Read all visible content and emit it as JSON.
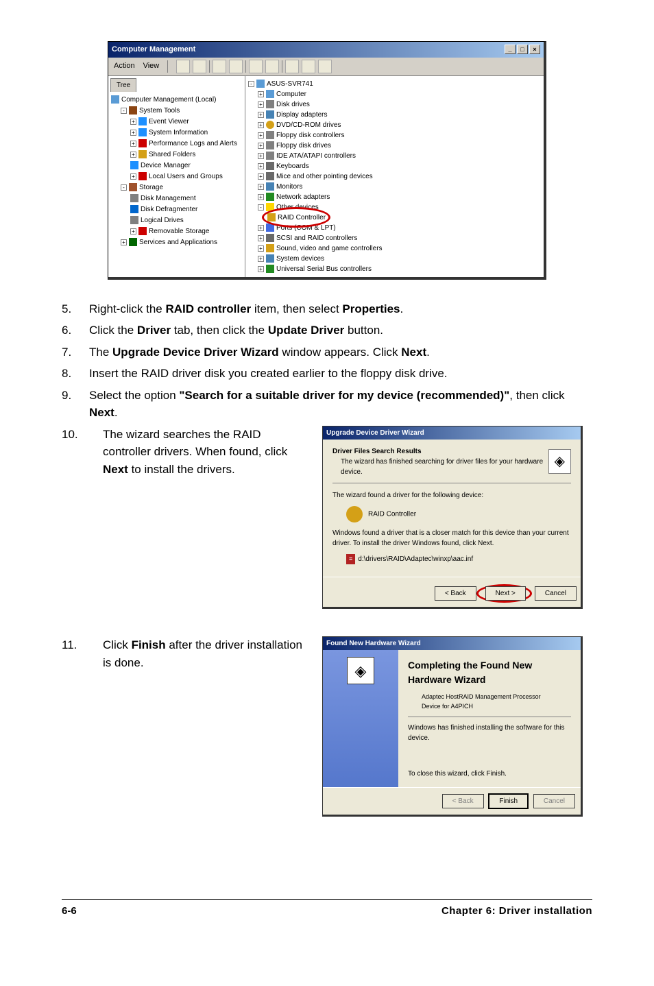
{
  "cm": {
    "title": "Computer Management",
    "menu": {
      "action": "Action",
      "view": "View"
    },
    "tab": "Tree",
    "root": "Computer Management (Local)",
    "systools": "System Tools",
    "event": "Event Viewer",
    "sysinfo": "System Information",
    "perf": "Performance Logs and Alerts",
    "shared": "Shared Folders",
    "devmgr": "Device Manager",
    "users": "Local Users and Groups",
    "storage": "Storage",
    "diskm": "Disk Management",
    "defrag": "Disk Defragmenter",
    "logical": "Logical Drives",
    "remov": "Removable Storage",
    "services": "Services and Applications",
    "host": "ASUS-SVR741",
    "computer": "Computer",
    "diskdrives": "Disk drives",
    "display": "Display adapters",
    "dvd": "DVD/CD-ROM drives",
    "floppyctl": "Floppy disk controllers",
    "floppydrv": "Floppy disk drives",
    "ide": "IDE ATA/ATAPI controllers",
    "kb": "Keyboards",
    "mouse": "Mice and other pointing devices",
    "monitors": "Monitors",
    "netad": "Network adapters",
    "other": "Other devices",
    "raidctl": "RAID Controller",
    "ports": "Ports (COM & LPT)",
    "scsi": "SCSI and RAID controllers",
    "sound": "Sound, video and game controllers",
    "sysdev": "System devices",
    "usb": "Universal Serial Bus controllers"
  },
  "instructions": {
    "i5": {
      "num": "5.",
      "pre": "Right-click the ",
      "b1": "RAID controller",
      "mid": " item, then select ",
      "b2": "Properties",
      "suf": "."
    },
    "i6": {
      "num": "6.",
      "pre": "Click the ",
      "b1": "Driver",
      "mid": " tab, then click the ",
      "b2": "Update Driver",
      "suf": " button."
    },
    "i7": {
      "num": "7.",
      "pre": "The ",
      "b1": "Upgrade Device Driver Wizard",
      "mid": " window appears. Click ",
      "b2": "Next",
      "suf": "."
    },
    "i8": {
      "num": "8.",
      "text": "Insert the RAID driver disk you created earlier to the floppy disk drive."
    },
    "i9": {
      "num": "9.",
      "pre": "Select the option ",
      "b1": "\"Search for a suitable driver for my device (recommended)\"",
      "mid": ", then click ",
      "b2": "Next",
      "suf": "."
    },
    "i10": {
      "num": "10.",
      "pre": "The wizard searches the RAID controller drivers. When found, click ",
      "b1": "Next",
      "suf": " to install the drivers."
    },
    "i11": {
      "num": "11.",
      "pre": "Click ",
      "b1": "Finish",
      "suf": " after the driver installation is done."
    }
  },
  "wizard": {
    "title": "Upgrade Device Driver Wizard",
    "hdr": "Driver Files Search Results",
    "hdrsub": "The wizard has finished searching for driver files for your hardware device.",
    "found": "The wizard found a driver for the following device:",
    "device": "RAID Controller",
    "notice": "Windows found a driver that is a closer match for this device than your current driver. To install the driver Windows found, click Next.",
    "path": "d:\\drivers\\RAID\\Adaptec\\winxp\\aac.inf",
    "back": "< Back",
    "next": "Next >",
    "cancel": "Cancel"
  },
  "hw": {
    "title": "Found New Hardware Wizard",
    "heading": "Completing the Found New Hardware Wizard",
    "dev1": "Adaptec HostRAID Management Processor",
    "dev2": "Device for A4PICH",
    "msg": "Windows has finished installing the software for this device.",
    "close": "To close this wizard, click Finish.",
    "back": "< Back",
    "finish": "Finish",
    "cancel": "Cancel"
  },
  "footer": {
    "page": "6-6",
    "chapter": "Chapter 6: Driver installation"
  }
}
